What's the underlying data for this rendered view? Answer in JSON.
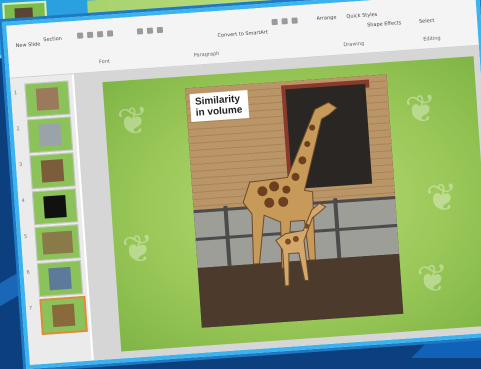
{
  "back_window": {},
  "ribbon": {
    "new_slide_label": "New Slide",
    "section_label": "Section",
    "font_group": "Font",
    "paragraph_group": "Paragraph",
    "convert_smartart": "Convert to SmartArt",
    "drawing_group": "Drawing",
    "arrange_label": "Arrange",
    "quick_styles_label": "Quick Styles",
    "shape_effects": "Shape Effects",
    "select_label": "Select",
    "editing_group": "Editing"
  },
  "slides": [
    {
      "index": "1"
    },
    {
      "index": "2"
    },
    {
      "index": "3"
    },
    {
      "index": "4"
    },
    {
      "index": "5"
    },
    {
      "index": "6"
    },
    {
      "index": "7"
    }
  ],
  "main_slide": {
    "caption": "Similarity\nin volume"
  },
  "colors": {
    "accent_border": "#3ab3ee",
    "slide_green": "#9cc95a",
    "background_blue": "#0b3f7e"
  }
}
